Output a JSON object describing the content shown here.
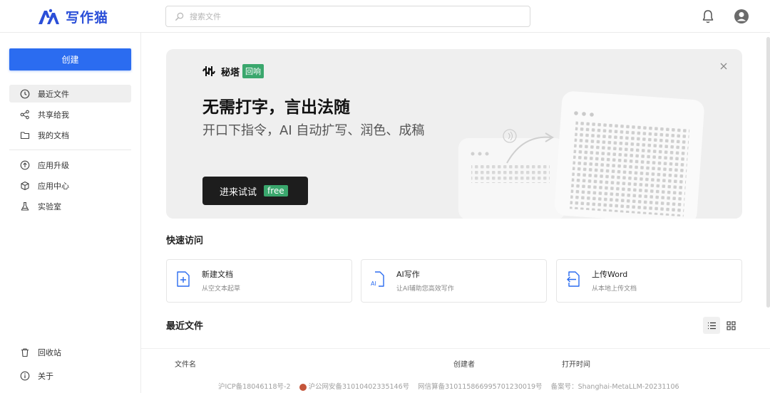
{
  "header": {
    "app_name": "写作猫",
    "search_placeholder": "搜索文件",
    "brand_color": "#2b4fd8"
  },
  "sidebar": {
    "create_label": "创建",
    "items": [
      {
        "label": "最近文件",
        "icon": "clock-icon",
        "active": true
      },
      {
        "label": "共享给我",
        "icon": "share-icon"
      },
      {
        "label": "我的文档",
        "icon": "folder-icon"
      },
      {
        "label": "应用升级",
        "icon": "upgrade-icon"
      },
      {
        "label": "应用中心",
        "icon": "cube-icon"
      },
      {
        "label": "实验室",
        "icon": "flask-icon"
      }
    ],
    "bottom_items": [
      {
        "label": "回收站",
        "icon": "trash-icon"
      },
      {
        "label": "关于",
        "icon": "info-icon"
      }
    ]
  },
  "banner": {
    "brand_name": "秘塔",
    "brand_badge": "回响",
    "title": "无需打字，言出法随",
    "subtitle": "开口下指令，AI 自动扩写、润色、成稿",
    "button_label": "进来试试",
    "button_tag": "free"
  },
  "quick_access": {
    "title": "快速访问",
    "cards": [
      {
        "title": "新建文档",
        "desc": "从空文本起草",
        "icon": "new-doc-icon"
      },
      {
        "title": "AI写作",
        "desc": "让AI辅助您高效写作",
        "icon": "ai-doc-icon"
      },
      {
        "title": "上传Word",
        "desc": "从本地上传文档",
        "icon": "upload-doc-icon"
      }
    ]
  },
  "recent": {
    "title": "最近文件",
    "columns": [
      "文件名",
      "创建者",
      "打开时间"
    ]
  },
  "footer": {
    "icp": "沪ICP备18046118号-2",
    "police": "沪公网安备31010402335146号",
    "algo": "网信算备310115866995701230019号",
    "record": "备案号：Shanghai-MetaLLM-20231106"
  }
}
